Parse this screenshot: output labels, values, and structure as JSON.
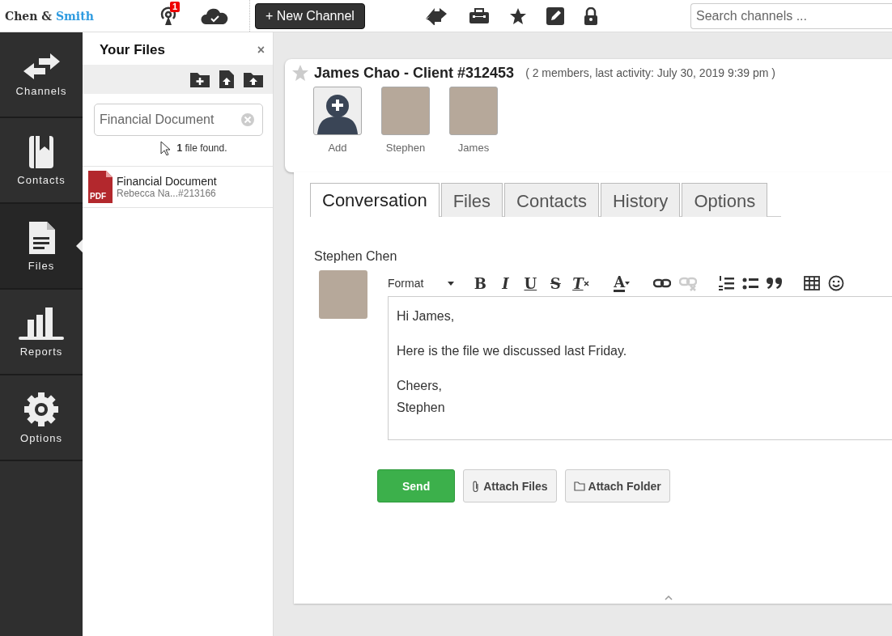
{
  "logo": {
    "first": "Chen &",
    "second": "Smith"
  },
  "topbar": {
    "notification_count": "1",
    "new_channel_button": "+ New Channel",
    "search": {
      "placeholder": "Search channels ..."
    }
  },
  "nav": [
    {
      "label": "Channels",
      "kind": "arrows",
      "selected": false
    },
    {
      "label": "Contacts",
      "kind": "book",
      "selected": false
    },
    {
      "label": "Files",
      "kind": "file",
      "selected": true
    },
    {
      "label": "Reports",
      "kind": "bars",
      "selected": false
    },
    {
      "label": "Options",
      "kind": "gear",
      "selected": false
    }
  ],
  "files_panel": {
    "title": "Your Files",
    "close": "×",
    "search": {
      "value": "Financial Document"
    },
    "result": "**1** file found.",
    "files": [
      {
        "name": "Financial Document",
        "meta": "Rebecca Na...#213166",
        "type_label": "PDF"
      }
    ]
  },
  "channel": {
    "title": "James Chao - Client #312453",
    "info": "( 2 members, last activity: July 30, 2019 9:39 pm )",
    "starred": false,
    "members": [
      {
        "name": "Add",
        "kind": "add"
      },
      {
        "name": "Stephen",
        "kind": "photo"
      },
      {
        "name": "James",
        "kind": "photo"
      }
    ]
  },
  "tabs": [
    {
      "label": "Conversation",
      "selected": true
    },
    {
      "label": "Files",
      "selected": false
    },
    {
      "label": "Contacts",
      "selected": false
    },
    {
      "label": "History",
      "selected": false
    },
    {
      "label": "Options",
      "selected": false
    }
  ],
  "composer": {
    "author": "Stephen Chen",
    "format_label": "Format",
    "toolbar": [
      {
        "kind": "bold",
        "label": "B",
        "disabled": false
      },
      {
        "kind": "italic",
        "label": "I",
        "disabled": false
      },
      {
        "kind": "underline",
        "label": "U",
        "disabled": false
      },
      {
        "kind": "strike",
        "label": "S",
        "disabled": false
      },
      {
        "kind": "clear",
        "label": "T",
        "disabled": false
      },
      {
        "kind": "color",
        "label": "A",
        "disabled": false
      },
      {
        "kind": "link",
        "disabled": false
      },
      {
        "kind": "unlink",
        "disabled": true
      },
      {
        "kind": "ol",
        "disabled": false
      },
      {
        "kind": "ul",
        "disabled": false
      },
      {
        "kind": "quote",
        "disabled": false
      },
      {
        "kind": "table",
        "disabled": false
      },
      {
        "kind": "emoji",
        "disabled": false
      }
    ],
    "paragraphs": [
      [
        "Hi James,"
      ],
      [
        "Here is the file we discussed last Friday."
      ],
      [
        "Cheers,",
        "Stephen"
      ]
    ],
    "buttons": [
      {
        "label": "Send",
        "kind": "primary"
      },
      {
        "label": "Attach Files",
        "kind": "clip"
      },
      {
        "label": "Attach Folder",
        "kind": "folder"
      }
    ]
  }
}
